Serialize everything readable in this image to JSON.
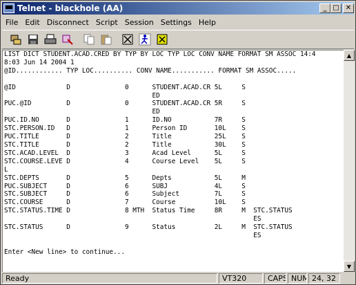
{
  "window": {
    "title": "Telnet - blackhole (AA)"
  },
  "menu": [
    "File",
    "Edit",
    "Disconnect",
    "Script",
    "Session",
    "Settings",
    "Help"
  ],
  "toolbar": {
    "icons": [
      "connect-icon",
      "save-icon",
      "print-icon",
      "properties-icon",
      "copy-icon",
      "paste-icon",
      "log-icon",
      "run-script-icon",
      "options-icon"
    ]
  },
  "terminal": {
    "lines": [
      "LIST DICT STUDENT.ACAD.CRED BY TYP BY LOC TYP LOC CONV NAME FORMAT SM ASSOC 14:4",
      "8:03 Jun 14 2004 1",
      "@ID............ TYP LOC.......... CONV NAME........... FORMAT SM ASSOC.....",
      "",
      "@ID             D              0      STUDENT.ACAD.CR 5L     S",
      "                                      ED",
      "PUC.@ID         D              0      STUDENT.ACAD.CR 5R     S",
      "                                      ED",
      "PUC.ID.NO       D              1      ID.NO           7R     S",
      "STC.PERSON.ID   D              1      Person ID       10L    S",
      "PUC.TITLE       D              2      Title           25L    S",
      "STC.TITLE       D              2      Title           30L    S",
      "STC.ACAD.LEVEL  D              3      Acad Level      5L     S",
      "STC.COURSE.LEVE D              4      Course Level    5L     S",
      "L",
      "STC.DEPTS       D              5      Depts           5L     M",
      "PUC.SUBJECT     D              6      SUBJ            4L     S",
      "STC.SUBJECT     D              6      Subject         7L     S",
      "STC.COURSE      D              7      Course          10L    S",
      "STC.STATUS.TIME D              8 MTH  Status Time     8R     M  STC.STATUS",
      "                                                                ES",
      "STC.STATUS      D              9      Status          2L     M  STC.STATUS",
      "                                                                ES",
      "",
      "Enter <New line> to continue..."
    ]
  },
  "status": {
    "ready": "Ready",
    "terminal_type": "VT320",
    "caps": "CAPS",
    "num": "NUM",
    "cursor": "24, 32"
  }
}
